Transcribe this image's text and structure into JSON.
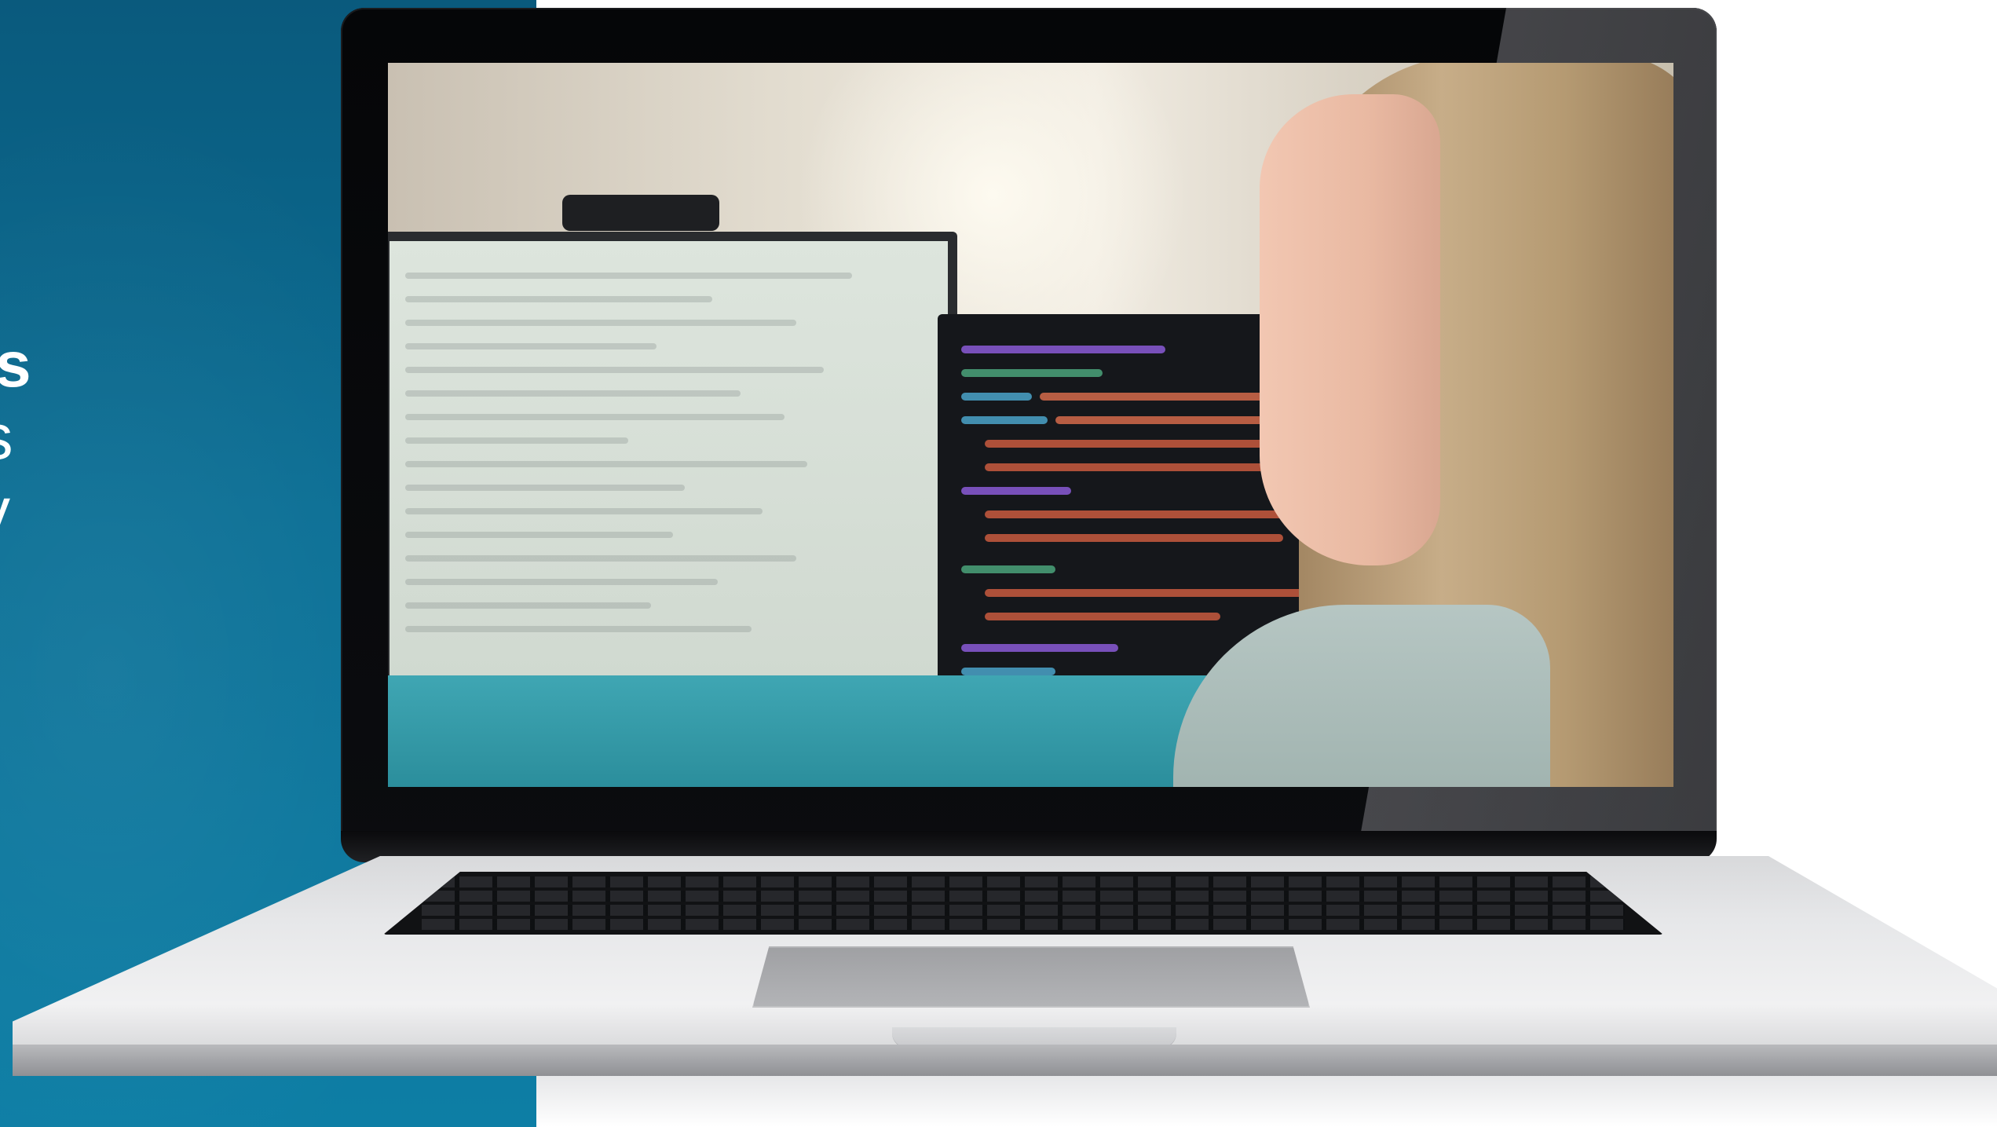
{
  "headline": {
    "line1": "s",
    "line2": "as",
    "line3": "y"
  },
  "colors": {
    "panel_blue": "#0b6f95",
    "laptop_black": "#0b0c0f",
    "laptop_silver": "#e6e7e9",
    "desk_teal": "#2b8e9c"
  },
  "screen": {
    "content": "video-frame"
  }
}
